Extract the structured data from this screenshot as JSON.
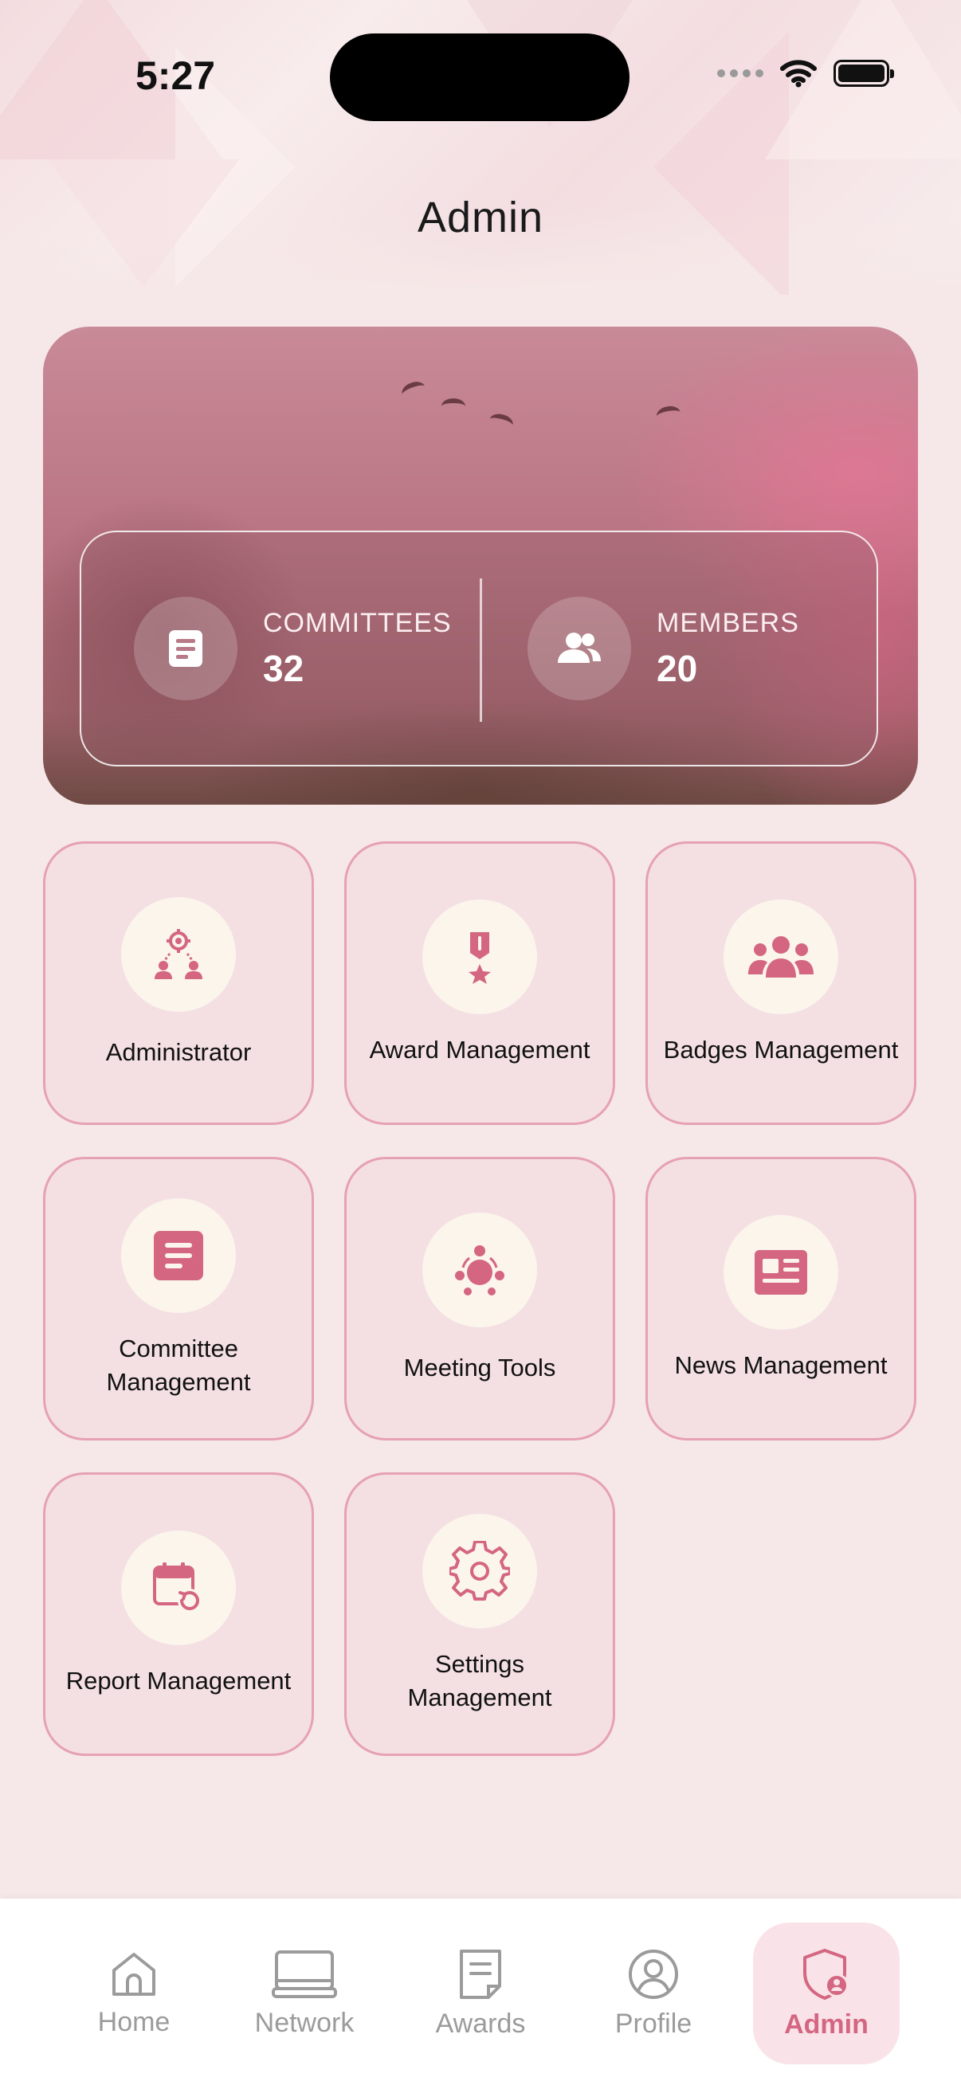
{
  "status_bar": {
    "time": "5:27"
  },
  "header": {
    "title": "Admin"
  },
  "stats": [
    {
      "label": "COMMITTEES",
      "value": "32",
      "icon": "document-icon"
    },
    {
      "label": "MEMBERS",
      "value": "20",
      "icon": "users-icon"
    }
  ],
  "tiles": [
    {
      "label": "Administrator",
      "icon": "admin-network-icon"
    },
    {
      "label": "Award Management",
      "icon": "medal-icon"
    },
    {
      "label": "Badges Management",
      "icon": "group-icon"
    },
    {
      "label": "Committee Management",
      "icon": "document-icon"
    },
    {
      "label": "Meeting Tools",
      "icon": "meeting-icon"
    },
    {
      "label": "News Management",
      "icon": "newspaper-icon"
    },
    {
      "label": "Report Management",
      "icon": "calendar-refresh-icon"
    },
    {
      "label": "Settings Management",
      "icon": "gear-icon"
    }
  ],
  "tabbar": {
    "items": [
      {
        "label": "Home",
        "icon": "home-icon"
      },
      {
        "label": "Network",
        "icon": "laptop-icon"
      },
      {
        "label": "Awards",
        "icon": "file-icon"
      },
      {
        "label": "Profile",
        "icon": "user-circle-icon"
      },
      {
        "label": "Admin",
        "icon": "shield-user-icon",
        "active": true
      }
    ]
  },
  "colors": {
    "accent": "#D46681",
    "tile_border": "#E6A1B3",
    "tile_bg": "#F4E0E3",
    "icon_bg": "#FBF5EC"
  }
}
